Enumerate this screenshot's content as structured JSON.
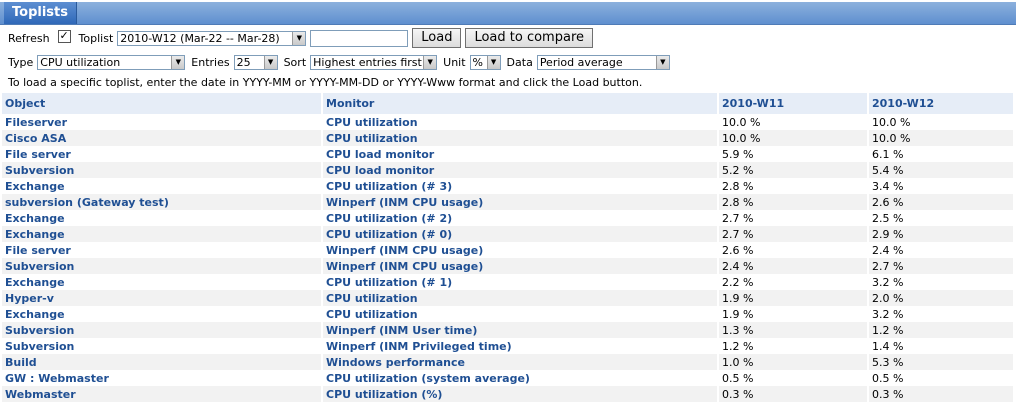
{
  "title": "Toplists",
  "controls": {
    "refresh_label": "Refresh",
    "refresh_checked": "✓",
    "toplist_label": "Toplist",
    "toplist_value": "2010-W12 (Mar-22 -- Mar-28)",
    "date_input_value": "",
    "load_button": "Load",
    "load_compare_button": "Load to compare",
    "type_label": "Type",
    "type_value": "CPU utilization",
    "entries_label": "Entries",
    "entries_value": "25",
    "sort_label": "Sort",
    "sort_value": "Highest entries first",
    "unit_label": "Unit",
    "unit_value": "%",
    "data_label": "Data",
    "data_value": "Period average"
  },
  "hint": "To load a specific toplist, enter the date in YYYY-MM or YYYY-MM-DD or YYYY-Www format and click the Load button.",
  "table": {
    "headers": [
      "Object",
      "Monitor",
      "2010-W11",
      "2010-W12"
    ],
    "rows": [
      [
        "Fileserver",
        "CPU utilization",
        "10.0 %",
        "10.0 %"
      ],
      [
        "Cisco ASA",
        "CPU utilization",
        "10.0 %",
        "10.0 %"
      ],
      [
        "File server",
        "CPU load monitor",
        "5.9 %",
        "6.1 %"
      ],
      [
        "Subversion",
        "CPU load monitor",
        "5.2 %",
        "5.4 %"
      ],
      [
        "Exchange",
        "CPU utilization (# 3)",
        "2.8 %",
        "3.4 %"
      ],
      [
        "subversion (Gateway test)",
        "Winperf (INM CPU usage)",
        "2.8 %",
        "2.6 %"
      ],
      [
        "Exchange",
        "CPU utilization (# 2)",
        "2.7 %",
        "2.5 %"
      ],
      [
        "Exchange",
        "CPU utilization (# 0)",
        "2.7 %",
        "2.9 %"
      ],
      [
        "File server",
        "Winperf (INM CPU usage)",
        "2.6 %",
        "2.4 %"
      ],
      [
        "Subversion",
        "Winperf (INM CPU usage)",
        "2.4 %",
        "2.7 %"
      ],
      [
        "Exchange",
        "CPU utilization (# 1)",
        "2.2 %",
        "3.2 %"
      ],
      [
        "Hyper-v",
        "CPU utilization",
        "1.9 %",
        "2.0 %"
      ],
      [
        "Exchange",
        "CPU utilization",
        "1.9 %",
        "3.2 %"
      ],
      [
        "Subversion",
        "Winperf (INM User time)",
        "1.3 %",
        "1.2 %"
      ],
      [
        "Subversion",
        "Winperf (INM Privileged time)",
        "1.2 %",
        "1.4 %"
      ],
      [
        "Build",
        "Windows performance",
        "1.0 %",
        "5.3 %"
      ],
      [
        "GW : Webmaster",
        "CPU utilization (system average)",
        "0.5 %",
        "0.5 %"
      ],
      [
        "Webmaster",
        "CPU utilization (%)",
        "0.3 %",
        "0.3 %"
      ]
    ]
  }
}
